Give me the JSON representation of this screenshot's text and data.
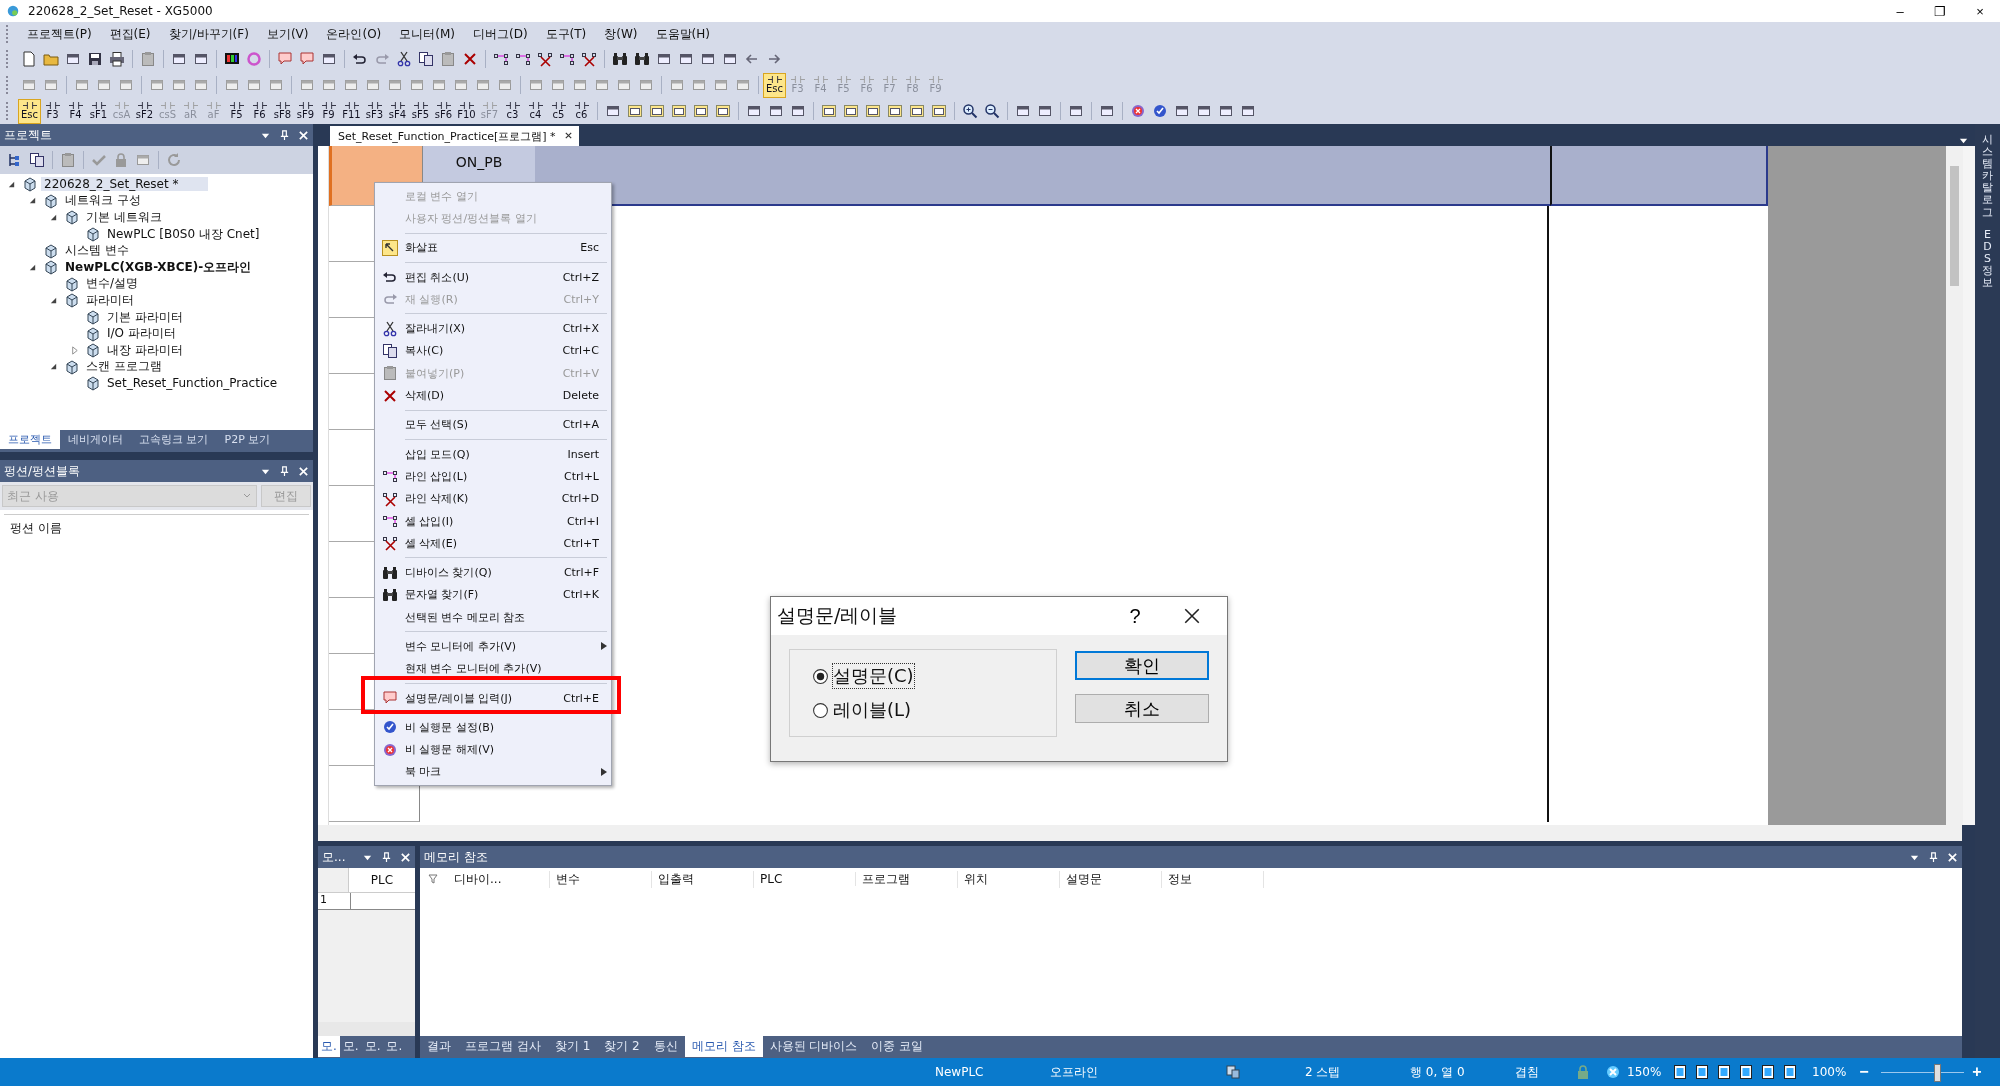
{
  "window": {
    "title": "220628_2_Set_Reset - XG5000",
    "controls": [
      "–",
      "❐",
      "×"
    ]
  },
  "menu": [
    "프로젝트(P)",
    "편집(E)",
    "찾기/바꾸기(F)",
    "보기(V)",
    "온라인(O)",
    "모니터(M)",
    "디버그(D)",
    "도구(T)",
    "창(W)",
    "도움말(H)"
  ],
  "toolbar_keys_top": [
    {
      "label": "Esc",
      "selected": true,
      "disabled": false
    },
    {
      "label": "F3",
      "selected": false,
      "disabled": true
    },
    {
      "label": "F4",
      "selected": false,
      "disabled": true
    },
    {
      "label": "F5",
      "selected": false,
      "disabled": true
    },
    {
      "label": "F6",
      "selected": false,
      "disabled": true
    },
    {
      "label": "F7",
      "selected": false,
      "disabled": true
    },
    {
      "label": "F8",
      "selected": false,
      "disabled": true
    },
    {
      "label": "F9",
      "selected": false,
      "disabled": true
    }
  ],
  "toolbar_keys": [
    {
      "label": "Esc",
      "selected": true,
      "disabled": false
    },
    {
      "label": "F3",
      "selected": false,
      "disabled": false
    },
    {
      "label": "F4",
      "selected": false,
      "disabled": false
    },
    {
      "label": "sF1",
      "selected": false,
      "disabled": false
    },
    {
      "label": "csA",
      "selected": false,
      "disabled": true
    },
    {
      "label": "sF2",
      "selected": false,
      "disabled": false
    },
    {
      "label": "csS",
      "selected": false,
      "disabled": true
    },
    {
      "label": "aR",
      "selected": false,
      "disabled": true
    },
    {
      "label": "aF",
      "selected": false,
      "disabled": true
    },
    {
      "label": "F5",
      "selected": false,
      "disabled": false
    },
    {
      "label": "F6",
      "selected": false,
      "disabled": false
    },
    {
      "label": "sF8",
      "selected": false,
      "disabled": false
    },
    {
      "label": "sF9",
      "selected": false,
      "disabled": false
    },
    {
      "label": "F9",
      "selected": false,
      "disabled": false
    },
    {
      "label": "F11",
      "selected": false,
      "disabled": false
    },
    {
      "label": "sF3",
      "selected": false,
      "disabled": false
    },
    {
      "label": "sF4",
      "selected": false,
      "disabled": false
    },
    {
      "label": "sF5",
      "selected": false,
      "disabled": false
    },
    {
      "label": "sF6",
      "selected": false,
      "disabled": false
    },
    {
      "label": "F10",
      "selected": false,
      "disabled": false
    },
    {
      "label": "sF7",
      "selected": false,
      "disabled": true
    },
    {
      "label": "c3",
      "selected": false,
      "disabled": false
    },
    {
      "label": "c4",
      "selected": false,
      "disabled": false
    },
    {
      "label": "c5",
      "selected": false,
      "disabled": false
    },
    {
      "label": "c6",
      "selected": false,
      "disabled": false
    }
  ],
  "project_panel": {
    "title": "프로젝트",
    "tree": [
      {
        "label": "220628_2_Set_Reset *",
        "expanded": true,
        "selected": true,
        "children": [
          {
            "label": "네트워크 구성",
            "expanded": true,
            "selected": false,
            "children": [
              {
                "label": "기본 네트워크",
                "expanded": true,
                "selected": false,
                "children": [
                  {
                    "label": "NewPLC [B0S0 내장 Cnet]",
                    "selected": false
                  }
                ]
              }
            ]
          },
          {
            "label": "시스템 변수",
            "selected": false
          },
          {
            "label": "NewPLC(XGB-XBCE)-오프라인",
            "expanded": true,
            "active": true,
            "selected": false,
            "children": [
              {
                "label": "변수/설명",
                "selected": false
              },
              {
                "label": "파라미터",
                "expanded": true,
                "selected": false,
                "children": [
                  {
                    "label": "기본 파라미터",
                    "selected": false
                  },
                  {
                    "label": "I/O 파라미터",
                    "selected": false
                  },
                  {
                    "label": "내장 파라미터",
                    "expanded": false,
                    "selected": false
                  }
                ]
              },
              {
                "label": "스캔 프로그램",
                "expanded": true,
                "selected": false,
                "children": [
                  {
                    "label": "Set_Reset_Function_Practice",
                    "selected": false
                  }
                ]
              }
            ]
          }
        ]
      }
    ],
    "tabs": [
      {
        "label": "프로젝트",
        "selected": true
      },
      {
        "label": "네비게이터",
        "selected": false
      },
      {
        "label": "고속링크 보기",
        "selected": false
      },
      {
        "label": "P2P 보기",
        "selected": false
      }
    ]
  },
  "function_panel": {
    "title": "펑션/펑션블록",
    "combo": {
      "value": "최근 사용",
      "disabled": true
    },
    "edit_button": {
      "label": "편집",
      "disabled": true
    },
    "column": "펑션 이름"
  },
  "editor": {
    "tab": {
      "label": "Set_Reset_Function_Practice[프로그램] *",
      "selected": true
    },
    "cell_label": "ON_PB"
  },
  "context_menu": [
    {
      "kind": "item",
      "label": "로컬 변수 열기",
      "disabled": true
    },
    {
      "kind": "item",
      "label": "사용자 펑션/펑션블록 열기",
      "disabled": true
    },
    {
      "kind": "separator"
    },
    {
      "kind": "item",
      "label": "화살표",
      "shortcut": "Esc",
      "disabled": false
    },
    {
      "kind": "separator"
    },
    {
      "kind": "item",
      "label": "편집 취소(U)",
      "shortcut": "Ctrl+Z",
      "disabled": false
    },
    {
      "kind": "item",
      "label": "재 실행(R)",
      "shortcut": "Ctrl+Y",
      "disabled": true
    },
    {
      "kind": "separator"
    },
    {
      "kind": "item",
      "label": "잘라내기(X)",
      "shortcut": "Ctrl+X",
      "disabled": false
    },
    {
      "kind": "item",
      "label": "복사(C)",
      "shortcut": "Ctrl+C",
      "disabled": false
    },
    {
      "kind": "item",
      "label": "붙여넣기(P)",
      "shortcut": "Ctrl+V",
      "disabled": true
    },
    {
      "kind": "item",
      "label": "삭제(D)",
      "shortcut": "Delete",
      "disabled": false
    },
    {
      "kind": "separator"
    },
    {
      "kind": "item",
      "label": "모두 선택(S)",
      "shortcut": "Ctrl+A",
      "disabled": false
    },
    {
      "kind": "separator"
    },
    {
      "kind": "item",
      "label": "삽입 모드(Q)",
      "shortcut": "Insert",
      "disabled": false
    },
    {
      "kind": "item",
      "label": "라인 삽입(L)",
      "shortcut": "Ctrl+L",
      "disabled": false
    },
    {
      "kind": "item",
      "label": "라인 삭제(K)",
      "shortcut": "Ctrl+D",
      "disabled": false
    },
    {
      "kind": "item",
      "label": "셀 삽입(I)",
      "shortcut": "Ctrl+I",
      "disabled": false
    },
    {
      "kind": "item",
      "label": "셀 삭제(E)",
      "shortcut": "Ctrl+T",
      "disabled": false
    },
    {
      "kind": "separator"
    },
    {
      "kind": "item",
      "label": "디바이스 찾기(Q)",
      "shortcut": "Ctrl+F",
      "disabled": false
    },
    {
      "kind": "item",
      "label": "문자열 찾기(F)",
      "shortcut": "Ctrl+K",
      "disabled": false
    },
    {
      "kind": "item",
      "label": "선택된 변수 메모리 참조",
      "disabled": false
    },
    {
      "kind": "separator"
    },
    {
      "kind": "item",
      "label": "변수 모니터에 추가(V)",
      "submenu": true,
      "disabled": false
    },
    {
      "kind": "item",
      "label": "현재 변수 모니터에 추가(V)",
      "disabled": false
    },
    {
      "kind": "separator"
    },
    {
      "kind": "item",
      "label": "설명문/레이블 입력(J)",
      "shortcut": "Ctrl+E",
      "disabled": false
    },
    {
      "kind": "separator"
    },
    {
      "kind": "item",
      "label": "비 실행문 설정(B)",
      "disabled": false
    },
    {
      "kind": "item",
      "label": "비 실행문 해제(V)",
      "disabled": false
    },
    {
      "kind": "item",
      "label": "북 마크",
      "submenu": true,
      "disabled": false
    }
  ],
  "dialog": {
    "title": "설명문/레이블",
    "help": "?",
    "options": [
      {
        "label": "설명문(C)",
        "selected": true
      },
      {
        "label": "레이블(L)",
        "selected": false
      }
    ],
    "buttons": [
      "확인",
      "취소"
    ]
  },
  "monitor_panel": {
    "title": "모...",
    "column": "PLC",
    "rows": [
      "1"
    ],
    "tabs": [
      {
        "label": "모.",
        "selected": true
      },
      {
        "label": "모.",
        "selected": false
      },
      {
        "label": "모.",
        "selected": false
      },
      {
        "label": "모.",
        "selected": false
      }
    ]
  },
  "memory_panel": {
    "title": "메모리 참조",
    "columns": [
      "디바이...",
      "변수",
      "입출력",
      "PLC",
      "프로그램",
      "위치",
      "설명문",
      "정보"
    ]
  },
  "output_tabs": [
    {
      "label": "결과",
      "selected": false
    },
    {
      "label": "프로그램 검사",
      "selected": false
    },
    {
      "label": "찾기 1",
      "selected": false
    },
    {
      "label": "찾기 2",
      "selected": false
    },
    {
      "label": "통신",
      "selected": false
    },
    {
      "label": "메모리 참조",
      "selected": true
    },
    {
      "label": "사용된 디바이스",
      "selected": false
    },
    {
      "label": "이중 코일",
      "selected": false
    }
  ],
  "side_strip": [
    "시스템 카탈로그",
    "EDS 정보"
  ],
  "status_bar": {
    "plc": "NewPLC",
    "mode": "오프라인",
    "steps": "2 스텝",
    "position": "행 0, 열 0",
    "insert_mode": "겹침",
    "scan_zoom": "150%",
    "zoom": "100%",
    "zoom_out": "−",
    "zoom_in": "+",
    "level": 0.68
  }
}
